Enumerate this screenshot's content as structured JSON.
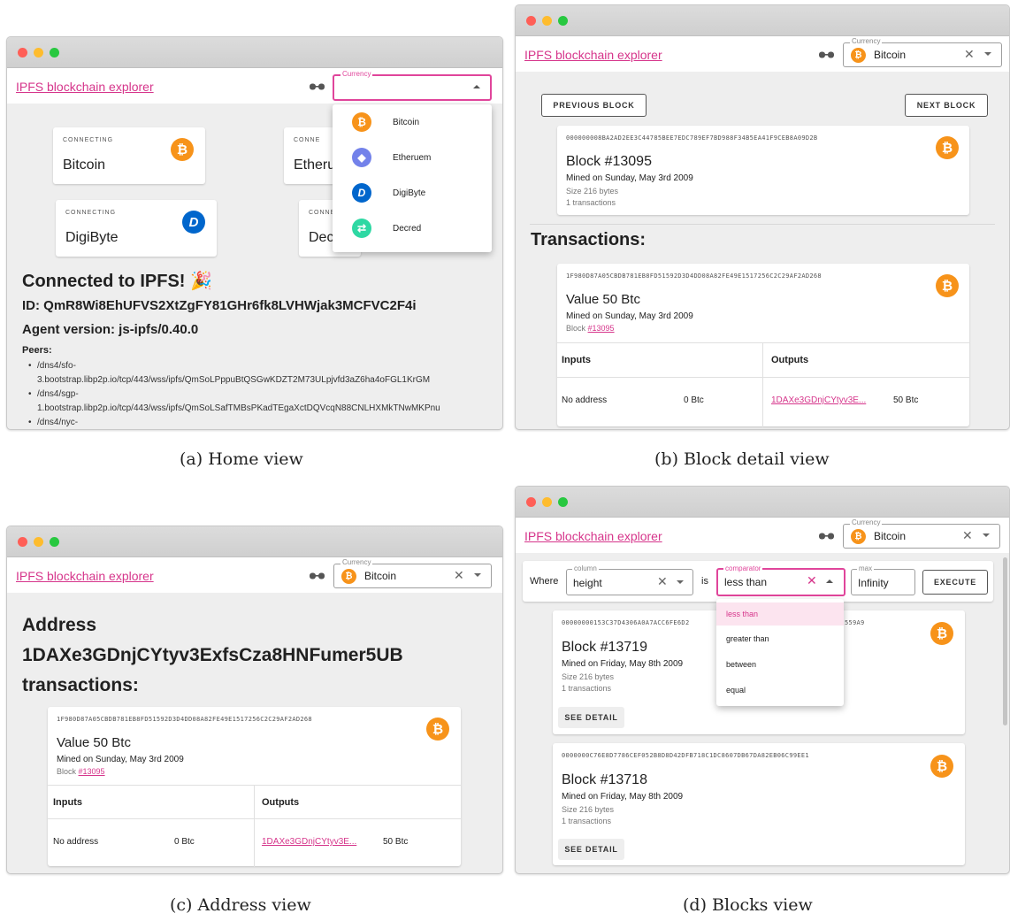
{
  "app_title": "IPFS blockchain explorer",
  "currency_label": "Currency",
  "currency_value": "Bitcoin",
  "captions": {
    "a": "(a) Home view",
    "b": "(b) Block detail view",
    "c": "(c) Address view",
    "d": "(d) Blocks view"
  },
  "home": {
    "connecting_label": "CONNECTING",
    "connecting_label_trunc": "CONNE",
    "coins": [
      "Bitcoin",
      "Etheru",
      "DigiByte",
      "Dec"
    ],
    "menu": [
      "Bitcoin",
      "Etheruem",
      "DigiByte",
      "Decred"
    ],
    "connected": "Connected to IPFS! 🎉",
    "id": "ID: QmR8Wi8EhUFVS2XtZgFY81GHr6fk8LVHWjak3MCFVC2F4i",
    "agent": "Agent version: js-ipfs/0.40.0",
    "peers_label": "Peers:",
    "peers": [
      {
        "l1": "/dns4/sfo-",
        "l2": "3.bootstrap.libp2p.io/tcp/443/wss/ipfs/QmSoLPppuBtQSGwKDZT2M73ULpjvfd3aZ6ha4oFGL1KrGM"
      },
      {
        "l1": "/dns4/sgp-",
        "l2": "1.bootstrap.libp2p.io/tcp/443/wss/ipfs/QmSoLSafTMBsPKadTEgaXctDQVcqN88CNLHXMkTNwMKPnu"
      },
      {
        "l1": "/dns4/nyc-",
        "l2": ""
      }
    ]
  },
  "block_detail": {
    "prev": "PREVIOUS BLOCK",
    "next": "NEXT BLOCK",
    "hash": "000000008BA2AD2EE3C44785BEE7EDC789EF7BD988F34B5EA41F9CEB8A09D2B",
    "title": "Block #13095",
    "mined": "Mined on Sunday, May 3rd 2009",
    "size": "Size 216 bytes",
    "txcount": "1 transactions",
    "transactions_heading": "Transactions:",
    "tx_hash": "1F980D87A05CBDB781EB8FD51592D3D4DD08A82FE49E1517256C2C29AF2AD268",
    "tx_value": "Value 50 Btc",
    "tx_mined": "Mined on Sunday, May 3rd 2009",
    "tx_block_prefix": "Block",
    "tx_block_link": "#13095",
    "inputs": "Inputs",
    "outputs": "Outputs",
    "in_addr": "No address",
    "in_val": "0 Btc",
    "out_addr": "1DAXe3GDnjCYtyv3E...",
    "out_val": "50 Btc"
  },
  "address": {
    "heading_l1": "Address",
    "heading_l2": "1DAXe3GDnjCYtyv3ExfsCza8HNFumer5UB",
    "heading_l3": "transactions:",
    "tx_hash": "1F980D87A05CBDB781EB8FD51592D3D4DD08A82FE49E1517256C2C29AF2AD268",
    "tx_value": "Value 50 Btc",
    "tx_mined": "Mined on Sunday, May 3rd 2009",
    "tx_block_prefix": "Block",
    "tx_block_link": "#13095",
    "inputs": "Inputs",
    "outputs": "Outputs",
    "in_addr": "No address",
    "in_val": "0 Btc",
    "out_addr": "1DAXe3GDnjCYtyv3E...",
    "out_val": "50 Btc"
  },
  "blocks": {
    "where": "Where",
    "column_label": "column",
    "column_value": "height",
    "is": "is",
    "comparator_label": "comparator",
    "comparator_value": "less than",
    "max_label": "max",
    "max_value": "Infinity",
    "execute": "EXECUTE",
    "options": [
      "less than",
      "greater than",
      "between",
      "equal"
    ],
    "list": [
      {
        "hash": "00000000153C37D4306A0A7ACC6FE6D2",
        "hash_tail": "559A9",
        "title": "Block #13719",
        "mined": "Mined on Friday, May 8th 2009",
        "size": "Size 216 bytes",
        "txcount": "1 transactions"
      },
      {
        "hash": "0000000C76E8D7786CEF052B8D8D42DFB718C1DC8607DB67DA82EB06C99EE1",
        "hash_tail": "",
        "title": "Block #13718",
        "mined": "Mined on Friday, May 8th 2009",
        "size": "Size 216 bytes",
        "txcount": "1 transactions"
      }
    ],
    "see_detail": "SEE DETAIL"
  }
}
